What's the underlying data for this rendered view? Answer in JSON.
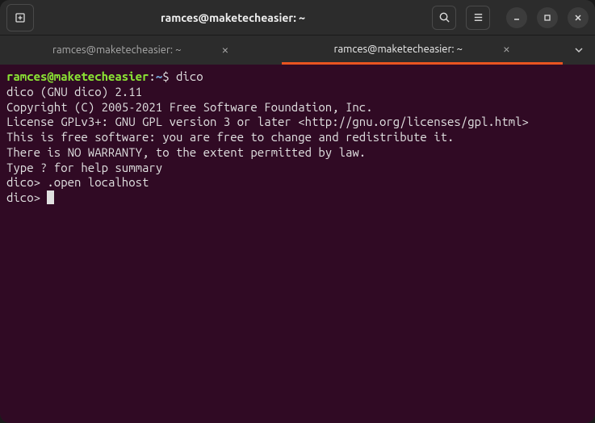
{
  "titlebar": {
    "title": "ramces@maketecheasier: ~"
  },
  "tabs": [
    {
      "label": "ramces@maketecheasier: ~",
      "active": false
    },
    {
      "label": "ramces@maketecheasier: ~",
      "active": true
    }
  ],
  "terminal": {
    "prompt_user": "ramces@maketecheasier",
    "prompt_path": "~",
    "prompt_symbol": "$",
    "command1": "dico",
    "output": [
      "dico (GNU dico) 2.11",
      "Copyright (C) 2005-2021 Free Software Foundation, Inc.",
      "License GPLv3+: GNU GPL version 3 or later <http://gnu.org/licenses/gpl.html>",
      "This is free software: you are free to change and redistribute it.",
      "There is NO WARRANTY, to the extent permitted by law.",
      "",
      "Type ? for help summary",
      ""
    ],
    "dico_prompt": "dico> ",
    "dico_cmd1": ".open localhost",
    "dico_prompt2": "dico> "
  }
}
